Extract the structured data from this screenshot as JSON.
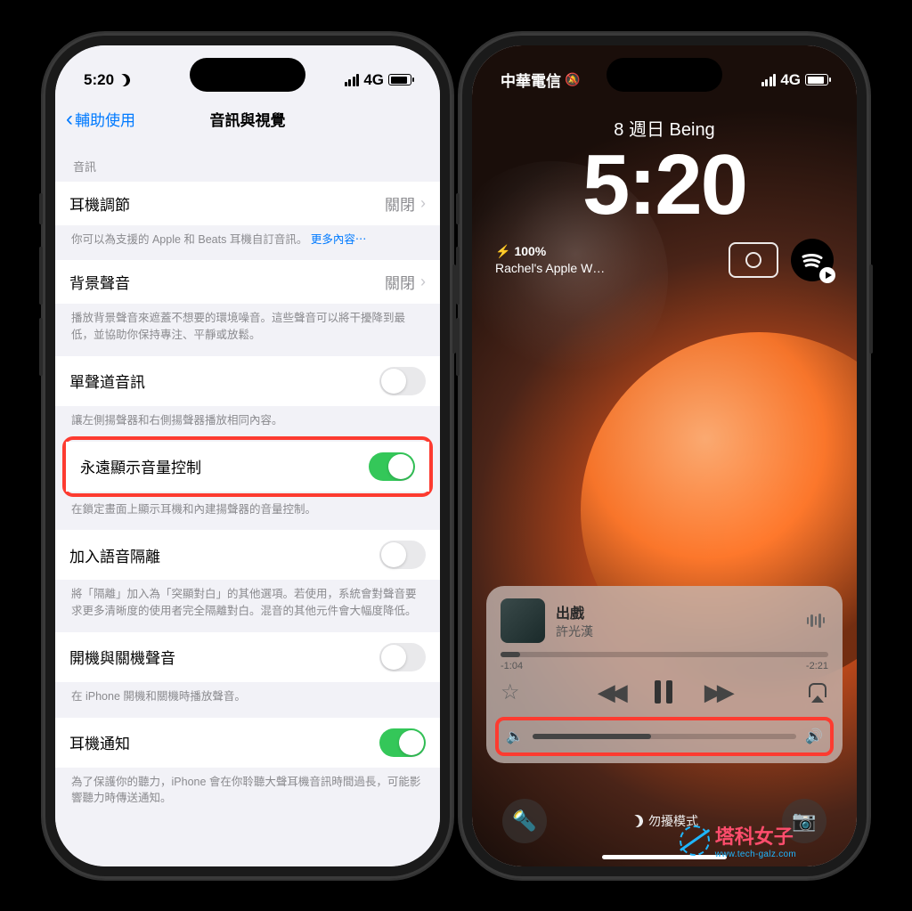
{
  "left": {
    "status": {
      "time": "5:20",
      "network": "4G"
    },
    "nav": {
      "back": "輔助使用",
      "title": "音訊與視覺"
    },
    "section_label": "音訊",
    "rows": {
      "headphone": {
        "label": "耳機調節",
        "value": "關閉"
      },
      "headphone_footer_a": "你可以為支援的 Apple 和 Beats 耳機自訂音訊。",
      "headphone_footer_more": "更多內容⋯",
      "bg_sound": {
        "label": "背景聲音",
        "value": "關閉"
      },
      "bg_footer": "播放背景聲音來遮蓋不想要的環境噪音。這些聲音可以將干擾降到最低，並協助你保持專注、平靜或放鬆。",
      "mono": {
        "label": "單聲道音訊"
      },
      "mono_footer": "讓左側揚聲器和右側揚聲器播放相同內容。",
      "always_vol": {
        "label": "永遠顯示音量控制"
      },
      "always_vol_footer": "在鎖定畫面上顯示耳機和內建揚聲器的音量控制。",
      "voice_iso": {
        "label": "加入語音隔離"
      },
      "voice_iso_footer": "將「隔離」加入為「突顯對白」的其他選項。若使用，系統會對聲音要求更多清晰度的使用者完全隔離對白。混音的其他元件會大幅度降低。",
      "power_sound": {
        "label": "開機與關機聲音"
      },
      "power_footer": "在 iPhone 開機和關機時播放聲音。",
      "hp_notify": {
        "label": "耳機通知"
      },
      "hp_notify_footer": "為了保護你的聽力，iPhone 會在你聆聽大聲耳機音訊時間過長，可能影響聽力時傳送通知。"
    }
  },
  "right": {
    "status": {
      "carrier": "中華電信",
      "network": "4G"
    },
    "date": "8 週日  Being",
    "time": "5:20",
    "battery_widget": {
      "pct": "100%",
      "device": "Rachel's Apple W…"
    },
    "player": {
      "title": "出戲",
      "artist": "許光漢",
      "elapsed": "-1:04",
      "remaining": "-2:21"
    },
    "focus": "勿擾模式"
  },
  "watermark": {
    "name": "塔科女子",
    "url": "www.tech-galz.com"
  }
}
